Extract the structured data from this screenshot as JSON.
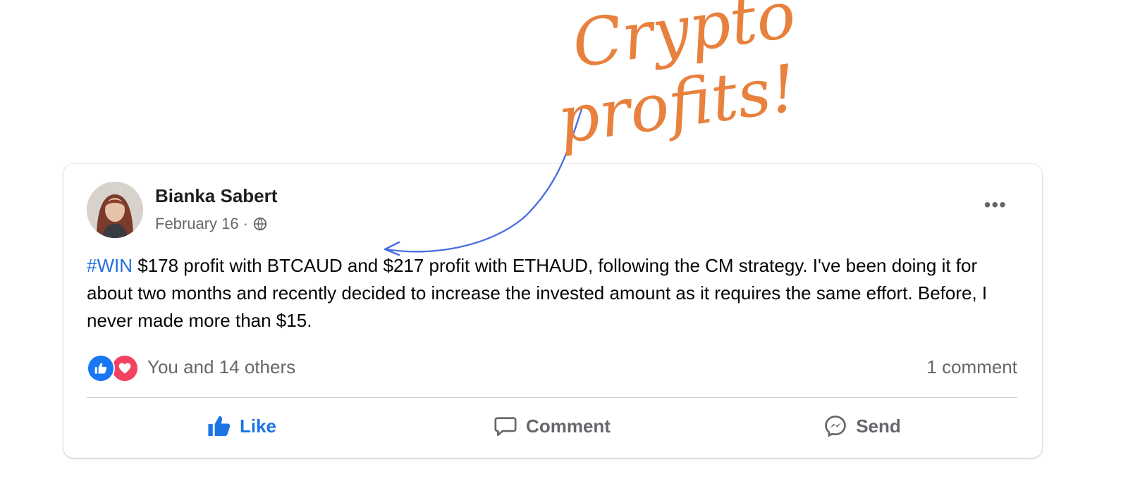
{
  "annotation": {
    "headline_line1": "Crypto",
    "headline_line2": "profits!",
    "colors": {
      "headline": "#e8813d",
      "arrow": "#4a6fe0"
    }
  },
  "post": {
    "author": "Bianka Sabert",
    "date": "February 16",
    "separator": " · ",
    "audience_icon": "globe-icon",
    "more_icon": "more-options-icon",
    "more_label": "•••",
    "hashtag": "#WIN",
    "body": " $178 profit with BTCAUD and $217 profit with ETHAUD, following the CM strategy. I've been doing it for about two months and recently decided to increase the invested amount as it requires the same effort. Before, I never made more than $15.",
    "reactions_text": "You and 14 others",
    "comments_text": "1 comment",
    "actions": {
      "like": "Like",
      "comment": "Comment",
      "send": "Send"
    },
    "colors": {
      "hashtag": "#216fdb",
      "like_active": "#1b74e4",
      "like_reaction": "#1877f2",
      "love_reaction": "#f3425f",
      "secondary_text": "#65676b"
    }
  }
}
